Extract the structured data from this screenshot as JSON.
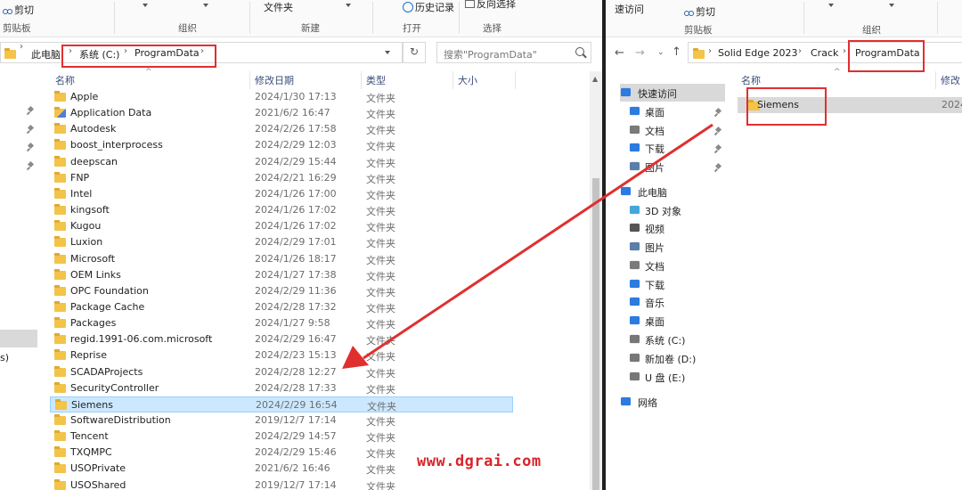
{
  "left_window": {
    "ribbon": {
      "cut": "剪切",
      "clipboard_group": "剪贴板",
      "organize_group": "组织",
      "new_group": "新建",
      "new_folder": "文件夹",
      "history": "历史记录",
      "open_group": "打开",
      "select_group": "选择",
      "select_all": "反向选择"
    },
    "address": {
      "crumbs": [
        "此电脑",
        "系统 (C:)",
        "ProgramData"
      ],
      "search_placeholder": "搜索\"ProgramData\""
    },
    "columns": {
      "name": "名称",
      "date": "修改日期",
      "type": "类型",
      "size": "大小"
    },
    "nav_partial": [
      "s)"
    ],
    "rows": [
      {
        "name": "Apple",
        "date": "2024/1/30 17:13",
        "type": "文件夹"
      },
      {
        "name": "Application Data",
        "date": "2021/6/2 16:47",
        "type": "文件夹"
      },
      {
        "name": "Autodesk",
        "date": "2024/2/26 17:58",
        "type": "文件夹"
      },
      {
        "name": "boost_interprocess",
        "date": "2024/2/29 12:03",
        "type": "文件夹"
      },
      {
        "name": "deepscan",
        "date": "2024/2/29 15:44",
        "type": "文件夹"
      },
      {
        "name": "FNP",
        "date": "2024/2/21 16:29",
        "type": "文件夹"
      },
      {
        "name": "Intel",
        "date": "2024/1/26 17:00",
        "type": "文件夹"
      },
      {
        "name": "kingsoft",
        "date": "2024/1/26 17:02",
        "type": "文件夹"
      },
      {
        "name": "Kugou",
        "date": "2024/1/26 17:02",
        "type": "文件夹"
      },
      {
        "name": "Luxion",
        "date": "2024/2/29 17:01",
        "type": "文件夹"
      },
      {
        "name": "Microsoft",
        "date": "2024/1/26 18:17",
        "type": "文件夹"
      },
      {
        "name": "OEM Links",
        "date": "2024/1/27 17:38",
        "type": "文件夹"
      },
      {
        "name": "OPC Foundation",
        "date": "2024/2/29 11:36",
        "type": "文件夹"
      },
      {
        "name": "Package Cache",
        "date": "2024/2/28 17:32",
        "type": "文件夹"
      },
      {
        "name": "Packages",
        "date": "2024/1/27 9:58",
        "type": "文件夹"
      },
      {
        "name": "regid.1991-06.com.microsoft",
        "date": "2024/2/29 16:47",
        "type": "文件夹"
      },
      {
        "name": "Reprise",
        "date": "2024/2/23 15:13",
        "type": "文件夹"
      },
      {
        "name": "SCADAProjects",
        "date": "2024/2/28 12:27",
        "type": "文件夹"
      },
      {
        "name": "SecurityController",
        "date": "2024/2/28 17:33",
        "type": "文件夹"
      },
      {
        "name": "Siemens",
        "date": "2024/2/29 16:54",
        "type": "文件夹"
      },
      {
        "name": "SoftwareDistribution",
        "date": "2019/12/7 17:14",
        "type": "文件夹"
      },
      {
        "name": "Tencent",
        "date": "2024/2/29 14:57",
        "type": "文件夹"
      },
      {
        "name": "TXQMPC",
        "date": "2024/2/29 15:46",
        "type": "文件夹"
      },
      {
        "name": "USOPrivate",
        "date": "2021/6/2 16:46",
        "type": "文件夹"
      },
      {
        "name": "USOShared",
        "date": "2019/12/7 17:14",
        "type": "文件夹"
      }
    ]
  },
  "right_window": {
    "ribbon": {
      "quick_access": "速访问",
      "cut": "剪切",
      "clipboard_group": "剪贴板",
      "organize_group": "组织"
    },
    "address": {
      "crumbs": [
        "Solid Edge 2023",
        "Crack",
        "ProgramData"
      ]
    },
    "columns": {
      "name": "名称",
      "date": "修改"
    },
    "file": {
      "name": "Siemens",
      "date": "2024"
    },
    "nav": [
      {
        "label": "快速访问",
        "icon": "star-icon"
      },
      {
        "label": "桌面",
        "icon": "desktop-icon"
      },
      {
        "label": "文档",
        "icon": "document-icon"
      },
      {
        "label": "下载",
        "icon": "download-icon"
      },
      {
        "label": "图片",
        "icon": "picture-icon"
      },
      {
        "label": "此电脑",
        "icon": "computer-icon"
      },
      {
        "label": "3D 对象",
        "icon": "cube-icon"
      },
      {
        "label": "视频",
        "icon": "video-icon"
      },
      {
        "label": "图片",
        "icon": "picture-icon"
      },
      {
        "label": "文档",
        "icon": "document-icon"
      },
      {
        "label": "下载",
        "icon": "download-icon"
      },
      {
        "label": "音乐",
        "icon": "music-icon"
      },
      {
        "label": "桌面",
        "icon": "desktop-icon"
      },
      {
        "label": "系统 (C:)",
        "icon": "drive-c-icon"
      },
      {
        "label": "新加卷 (D:)",
        "icon": "drive-icon"
      },
      {
        "label": "U 盘 (E:)",
        "icon": "usb-drive-icon"
      },
      {
        "label": "网络",
        "icon": "network-icon"
      }
    ]
  },
  "watermark": "www.dgrai.com",
  "colors": {
    "highlight": "#e02f2f",
    "selection": "#cce8ff",
    "folder": "#f3c34a"
  }
}
